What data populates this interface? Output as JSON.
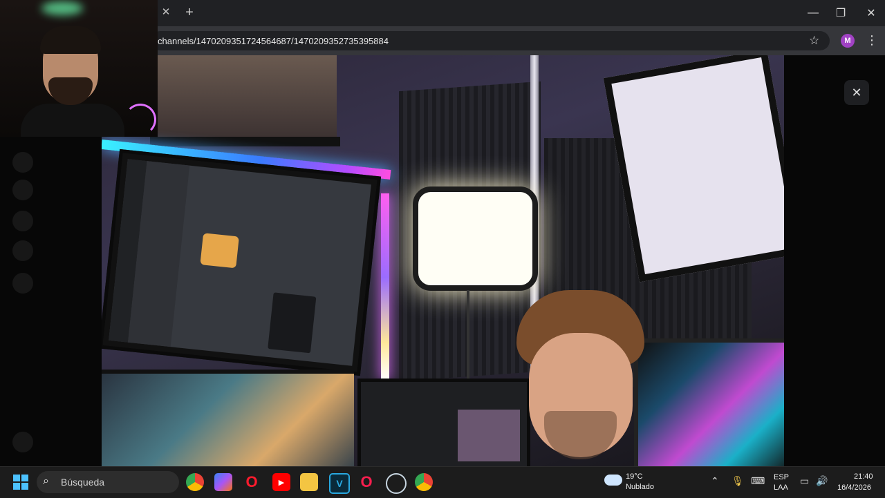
{
  "browser": {
    "url": "channels/1470209351724564687/1470209352735395884",
    "profile_initial": "M",
    "icons": {
      "tab_close": "close-icon",
      "new_tab": "plus-icon",
      "bookmark": "star-icon",
      "menu": "kebab-icon",
      "minimize": "minimize-icon",
      "restore": "restore-icon",
      "close": "close-icon"
    }
  },
  "viewer": {
    "close_icon": "close-icon"
  },
  "taskbar": {
    "search_placeholder": "Búsqueda",
    "weather_temp": "19°C",
    "weather_desc": "Nublado",
    "lang_line1": "ESP",
    "lang_line2": "LAA",
    "time": "21:40",
    "date": "16/4/2026",
    "apps": [
      "chrome-icon",
      "copilot-icon",
      "opera-icon",
      "youtube-icon",
      "file-explorer-icon",
      "v-app-icon",
      "opera-gx-icon",
      "steam-icon",
      "chrome-profile-icon"
    ]
  },
  "colors": {
    "tabstrip": "#202124",
    "toolbar": "#35363a",
    "profile": "#a142c4",
    "taskbar": "#1c1c1c",
    "windows_accent": "#4cc2ff"
  }
}
